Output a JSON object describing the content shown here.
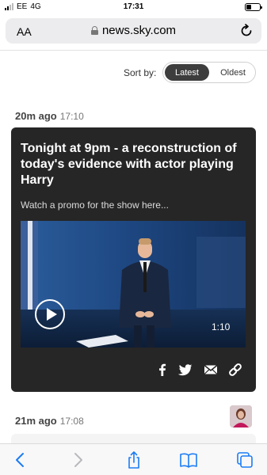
{
  "status_bar": {
    "carrier": "EE",
    "network": "4G",
    "time": "17:31"
  },
  "address_bar": {
    "text_size": "AA",
    "url": "news.sky.com"
  },
  "sort": {
    "label": "Sort by:",
    "options": [
      "Latest",
      "Oldest"
    ],
    "selected": "Latest"
  },
  "posts": [
    {
      "ago": "20m ago",
      "time": "17:10",
      "title": "Tonight at 9pm - a reconstruction of today's evidence with actor playing Harry",
      "subtitle": "Watch a promo for the show here...",
      "video_duration": "1:10",
      "share_icons": [
        "facebook-icon",
        "twitter-icon",
        "email-icon",
        "link-icon"
      ]
    },
    {
      "ago": "21m ago",
      "time": "17:08"
    }
  ],
  "toolbar": {
    "icons": [
      "back-icon",
      "forward-icon",
      "share-icon",
      "bookmarks-icon",
      "tabs-icon"
    ]
  },
  "colors": {
    "accent_blue": "#1b7cf5",
    "card_bg": "#262626",
    "toggle_selected": "#3d3d3d"
  }
}
